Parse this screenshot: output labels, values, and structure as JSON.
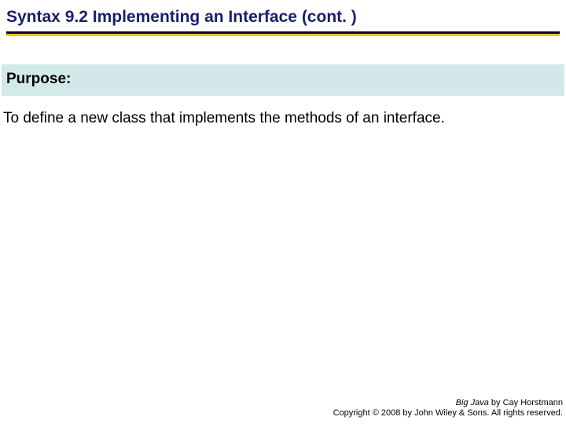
{
  "slide": {
    "title_prefix": "Syntax 9.2",
    "title_main": " Implementing an Interface ",
    "title_cont": " (cont. )",
    "purpose_label": "Purpose:",
    "purpose_body": "To define a new class that implements the methods of an interface."
  },
  "footer": {
    "book": "Big Java",
    "byline": " by Cay Horstmann",
    "copyright": "Copyright © 2008 by John Wiley & Sons. All rights reserved."
  },
  "colors": {
    "title_text": "#19216a",
    "underline_dark": "#000040",
    "underline_yellow": "#f2c40e",
    "purpose_bg": "#d3e8e8"
  }
}
